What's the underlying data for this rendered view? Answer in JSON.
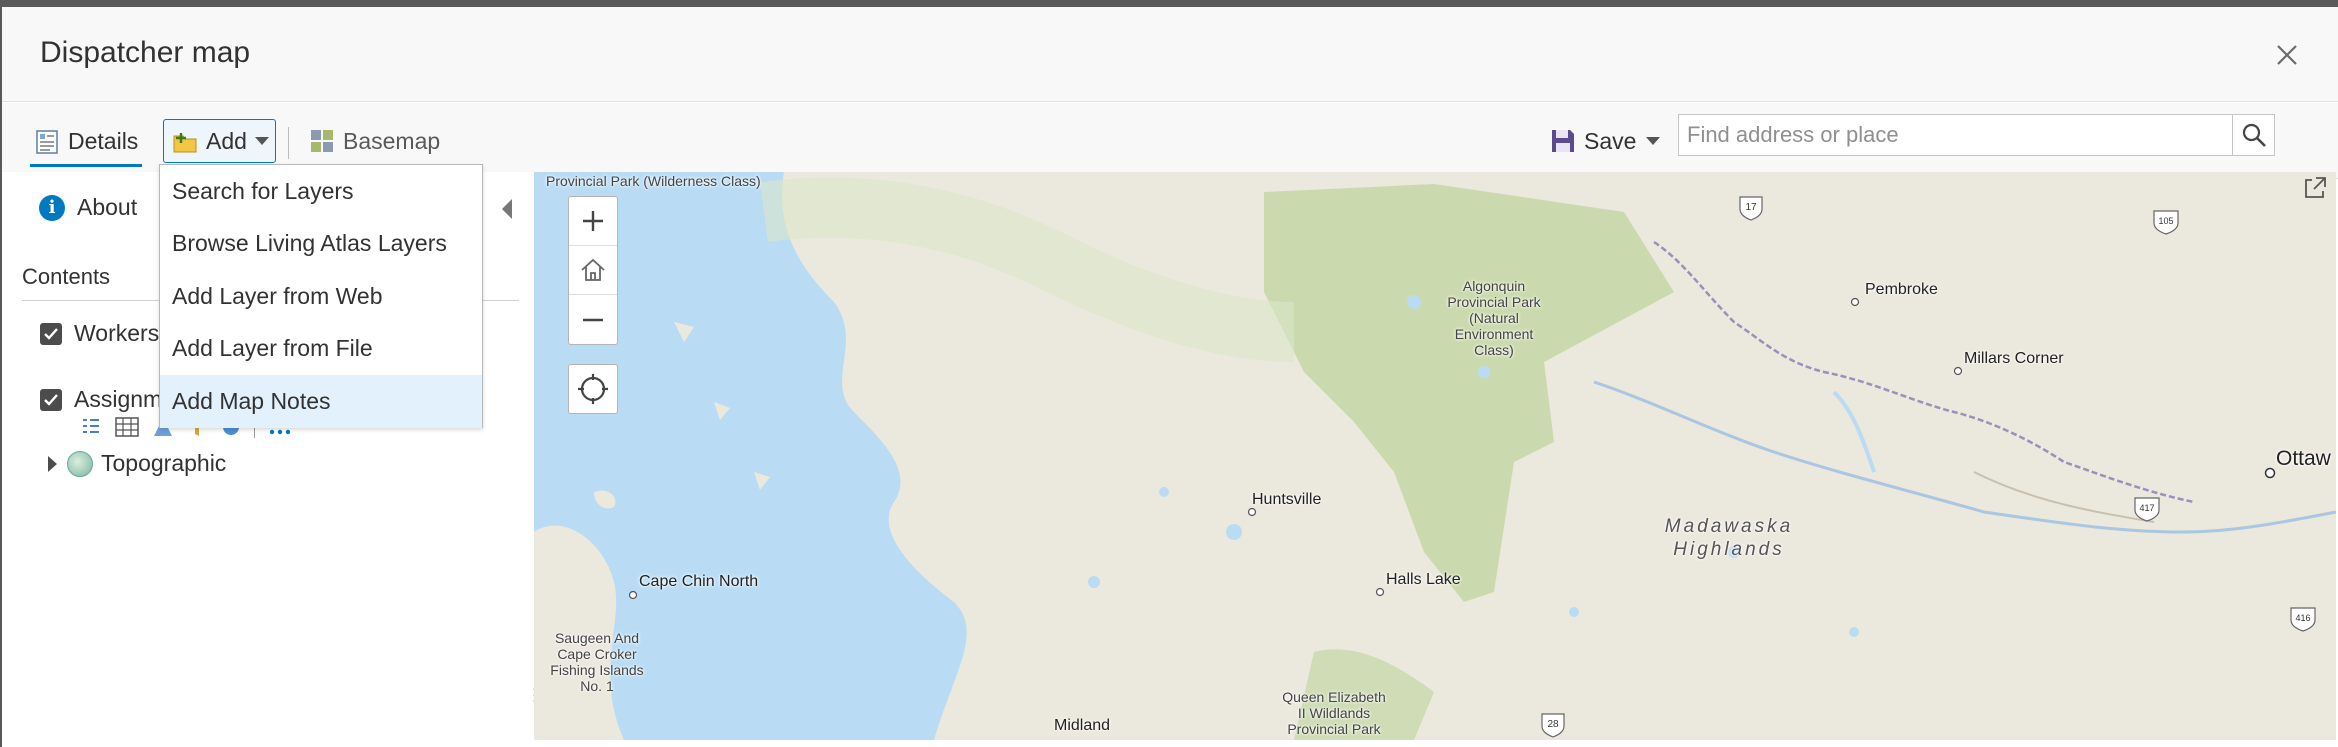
{
  "window": {
    "title": "Dispatcher map"
  },
  "toolbar": {
    "details_label": "Details",
    "add_label": "Add",
    "basemap_label": "Basemap",
    "save_label": "Save"
  },
  "search": {
    "placeholder": "Find address or place"
  },
  "add_menu": {
    "items": [
      {
        "label": "Search for Layers"
      },
      {
        "label": "Browse Living Atlas Layers"
      },
      {
        "label": "Add Layer from Web"
      },
      {
        "label": "Add Layer from File"
      },
      {
        "label": "Add Map Notes"
      }
    ]
  },
  "sidebar": {
    "about_label": "About",
    "contents_label": "Contents",
    "layers": [
      {
        "label": "Workers",
        "checked": true
      },
      {
        "label": "Assignm",
        "checked": true
      },
      {
        "label": "Topographic"
      }
    ]
  },
  "map": {
    "labels": {
      "provincial_park_top": "Provincial Park (Wilderness Class)",
      "algonquin": "Algonquin Provincial Park (Natural Environment Class)",
      "pembroke": "Pembroke",
      "millars_corner": "Millars Corner",
      "ottawa": "Ottaw",
      "huntsville": "Huntsville",
      "madawaska": "Madawaska Highlands",
      "halls_lake": "Halls Lake",
      "cape_chin_north": "Cape Chin North",
      "saugeen": "Saugeen And Cape Croker Fishing Islands No. 1",
      "queen_elizabeth": "Queen Elizabeth II Wildlands Provincial Park",
      "midland": "Midland",
      "hwy17": "17",
      "hwy105": "105",
      "hwy417": "417",
      "hwy416": "416",
      "hwy28": "28"
    }
  }
}
